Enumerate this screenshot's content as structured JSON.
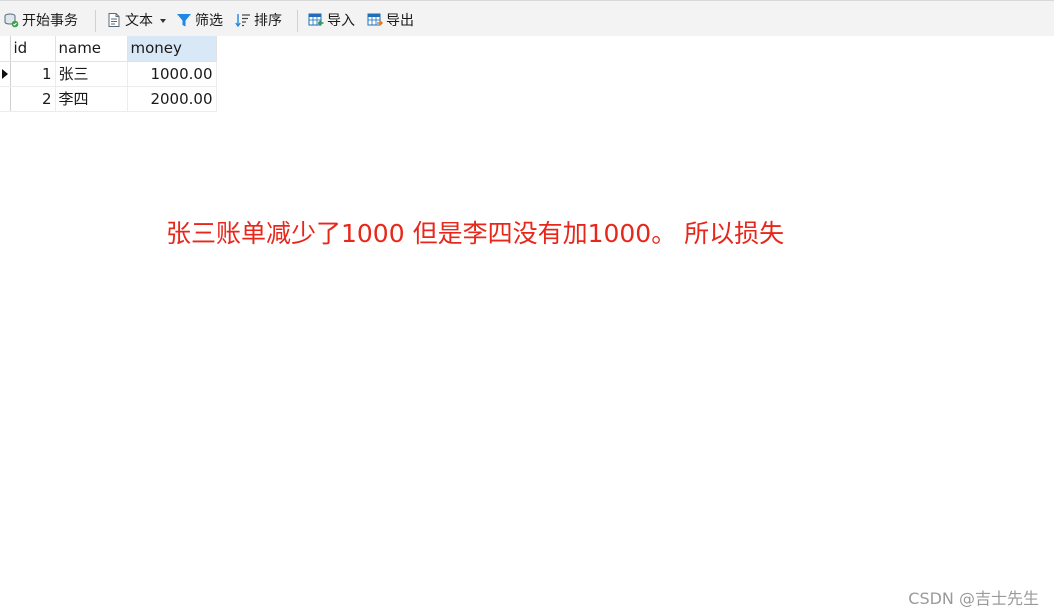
{
  "toolbar": {
    "begin_transaction": "开始事务",
    "text": "文本",
    "filter": "筛选",
    "sort": "排序",
    "import": "导入",
    "export": "导出"
  },
  "table": {
    "columns": [
      "id",
      "name",
      "money"
    ],
    "selected_column": "money",
    "rows": [
      {
        "id": "1",
        "name": "张三",
        "money": "1000.00"
      },
      {
        "id": "2",
        "name": "李四",
        "money": "2000.00"
      }
    ]
  },
  "annotation": "张三账单减少了1000 但是李四没有加1000。 所以损失",
  "watermark": "CSDN @吉士先生",
  "colors": {
    "annotation": "#e8271b",
    "toolbar_bg": "#f3f3f3",
    "selected_header_bg": "#d9e8f7",
    "filter_icon": "#1e88e5"
  },
  "icons": {
    "begin_transaction": "transaction-icon",
    "text": "document-icon",
    "filter": "funnel-icon",
    "sort": "sort-icon",
    "import": "table-import-icon",
    "export": "table-export-icon",
    "current_row": "row-pointer-icon"
  }
}
